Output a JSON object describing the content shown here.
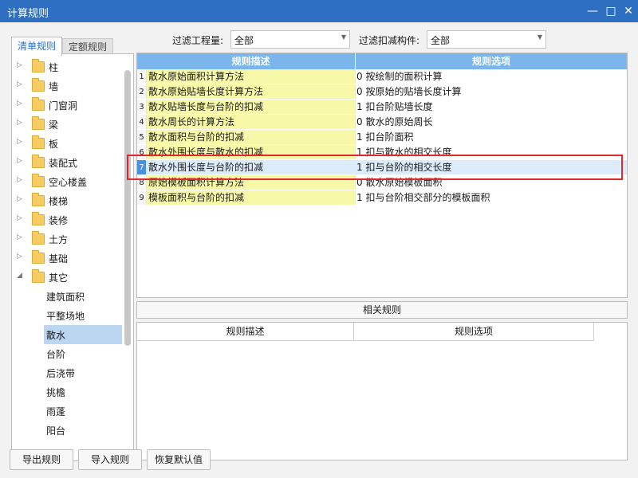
{
  "window": {
    "title": "计算规则",
    "min_icon": "minimize-icon",
    "max_icon": "maximize-icon",
    "close_icon": "close-icon"
  },
  "tabs": [
    {
      "label": "清单规则",
      "active": true
    },
    {
      "label": "定额规则",
      "active": false
    }
  ],
  "filters": {
    "project_label": "过滤工程量:",
    "project_value": "全部",
    "component_label": "过滤扣减构件:",
    "component_value": "全部"
  },
  "tree": {
    "items": [
      "柱",
      "墙",
      "门窗洞",
      "梁",
      "板",
      "装配式",
      "空心楼盖",
      "楼梯",
      "装修",
      "土方",
      "基础",
      "其它"
    ],
    "expanded": "其它",
    "children": [
      "建筑面积",
      "平整场地",
      "散水",
      "台阶",
      "后浇带",
      "挑檐",
      "雨蓬",
      "阳台"
    ],
    "selected_child": "散水"
  },
  "rules_table": {
    "headers": {
      "description": "规则描述",
      "option": "规则选项"
    },
    "rows": [
      {
        "n": "1",
        "description": "散水原始面积计算方法",
        "option": "0 按绘制的面积计算"
      },
      {
        "n": "2",
        "description": "散水原始贴墙长度计算方法",
        "option": "0 按原始的贴墙长度计算"
      },
      {
        "n": "3",
        "description": "散水贴墙长度与台阶的扣减",
        "option": "1 扣台阶贴墙长度"
      },
      {
        "n": "4",
        "description": "散水周长的计算方法",
        "option": "0 散水的原始周长"
      },
      {
        "n": "5",
        "description": "散水面积与台阶的扣减",
        "option": "1 扣台阶面积"
      },
      {
        "n": "6",
        "description": "散水外围长度与散水的扣减",
        "option": "1 扣与散水的相交长度"
      },
      {
        "n": "7",
        "description": "散水外围长度与台阶的扣减",
        "option": "1 扣与台阶的相交长度"
      },
      {
        "n": "8",
        "description": "原始模板面积计算方法",
        "option": "0 散水原始模板面积"
      },
      {
        "n": "9",
        "description": "模板面积与台阶的扣减",
        "option": "1 扣与台阶相交部分的模板面积"
      }
    ],
    "highlighted_row": "7"
  },
  "related": {
    "title": "相关规则",
    "headers": {
      "description": "规则描述",
      "option": "规则选项"
    }
  },
  "buttons": {
    "export": "导出规则",
    "import": "导入规则",
    "restore": "恢复默认值"
  },
  "colors": {
    "titlebar": "#2f6fc1",
    "header": "#7ab5ec",
    "desc_cell": "#f8f9a8",
    "highlight_box": "#e02a2a",
    "selected": "#bcd6f2"
  }
}
